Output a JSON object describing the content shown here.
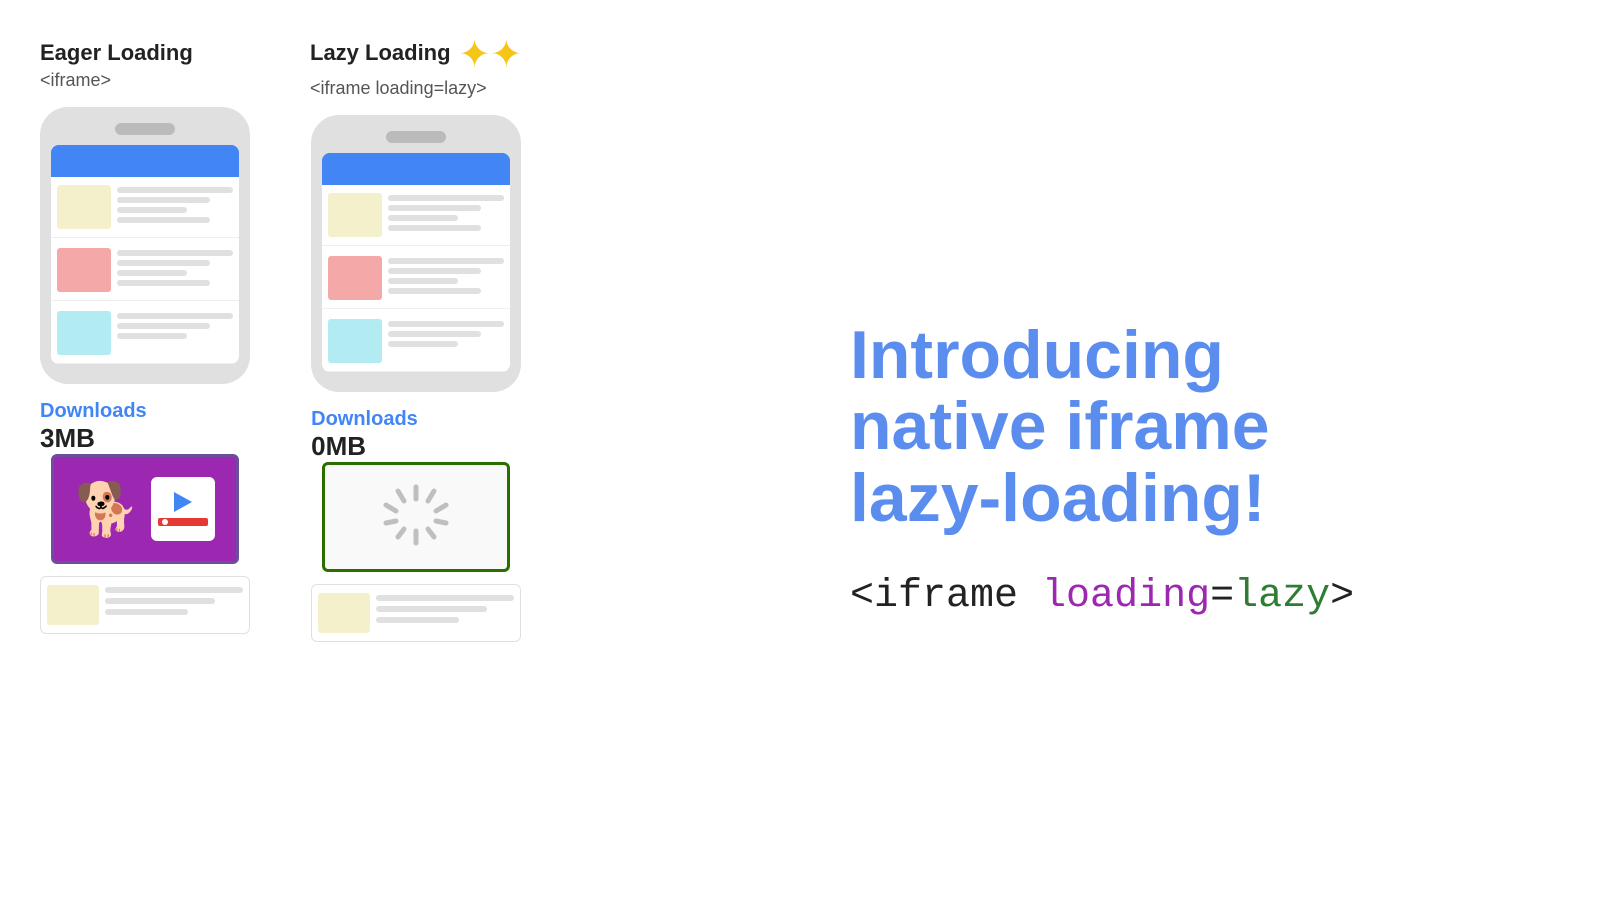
{
  "eager": {
    "title": "Eager Loading",
    "subtitle": "<iframe>",
    "downloads_label": "Downloads",
    "downloads_value": "3MB"
  },
  "lazy": {
    "title": "Lazy Loading",
    "subtitle": "<iframe loading=lazy>",
    "downloads_label": "Downloads",
    "downloads_value": "0MB"
  },
  "headline": {
    "line1": "Introducing",
    "line2": "native iframe",
    "line3": "lazy-loading!"
  },
  "code": {
    "open_bracket": "<",
    "tag": "iframe",
    "attr": " loading",
    "equals": "=",
    "value": "lazy",
    "close_bracket": ">"
  },
  "sparkle": "✦✦"
}
